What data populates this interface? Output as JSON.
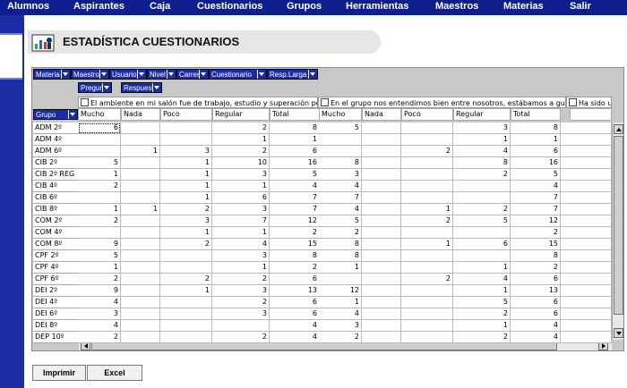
{
  "nav": [
    "Alumnos",
    "Aspirantes",
    "Caja",
    "Cuestionarios",
    "Grupos",
    "Herramientas",
    "Maestros",
    "Materias",
    "Salir"
  ],
  "page_title": "ESTADÍSTICA CUESTIONARIOS",
  "filter_fields": [
    "Materia",
    "Maestro",
    "Usuario",
    "Nivel",
    "Carrera",
    "Cuestionario",
    "Resp.Larga"
  ],
  "column_fields": [
    "Pregunta",
    "Respuesta"
  ],
  "row_field": "Grupo",
  "questions": [
    "El ambiente en mi salón fue de trabajo, estudio y superación personal.",
    "En el grupo nos entendimos bien entre nosotros, estábamos a gusto.",
    "Ha sido un"
  ],
  "answer_columns": [
    "Mucho",
    "Nada",
    "Poco",
    "Regular",
    "Total"
  ],
  "rows": [
    {
      "g": "ADM 2º",
      "q1": [
        "6",
        "",
        "",
        "2",
        "8"
      ],
      "q2": [
        "5",
        "",
        "",
        "3",
        "8"
      ]
    },
    {
      "g": "ADM 4º",
      "q1": [
        "",
        "",
        "",
        "1",
        "1"
      ],
      "q2": [
        "",
        "",
        "",
        "1",
        "1"
      ]
    },
    {
      "g": "ADM 6º",
      "q1": [
        "",
        "1",
        "3",
        "2",
        "6"
      ],
      "q2": [
        "",
        "",
        "2",
        "4",
        "6"
      ]
    },
    {
      "g": "CIB 2º",
      "q1": [
        "5",
        "",
        "1",
        "10",
        "16"
      ],
      "q2": [
        "8",
        "",
        "",
        "8",
        "16"
      ]
    },
    {
      "g": "CIB 2º REG",
      "q1": [
        "1",
        "",
        "1",
        "3",
        "5"
      ],
      "q2": [
        "3",
        "",
        "",
        "2",
        "5"
      ]
    },
    {
      "g": "CIB 4º",
      "q1": [
        "2",
        "",
        "1",
        "1",
        "4"
      ],
      "q2": [
        "4",
        "",
        "",
        "",
        "4"
      ]
    },
    {
      "g": "CIB 6º",
      "q1": [
        "",
        "",
        "1",
        "6",
        "7"
      ],
      "q2": [
        "7",
        "",
        "",
        "",
        "7"
      ]
    },
    {
      "g": "CIB 8º",
      "q1": [
        "1",
        "1",
        "2",
        "3",
        "7"
      ],
      "q2": [
        "4",
        "",
        "1",
        "2",
        "7"
      ]
    },
    {
      "g": "COM 2º",
      "q1": [
        "2",
        "",
        "3",
        "7",
        "12"
      ],
      "q2": [
        "5",
        "",
        "2",
        "5",
        "12"
      ]
    },
    {
      "g": "COM 4º",
      "q1": [
        "",
        "",
        "1",
        "1",
        "2"
      ],
      "q2": [
        "2",
        "",
        "",
        "",
        "2"
      ]
    },
    {
      "g": "COM 8º",
      "q1": [
        "9",
        "",
        "2",
        "4",
        "15"
      ],
      "q2": [
        "8",
        "",
        "1",
        "6",
        "15"
      ]
    },
    {
      "g": "CPF 2º",
      "q1": [
        "5",
        "",
        "",
        "3",
        "8"
      ],
      "q2": [
        "8",
        "",
        "",
        "",
        "8"
      ]
    },
    {
      "g": "CPF 4º",
      "q1": [
        "1",
        "",
        "",
        "1",
        "2"
      ],
      "q2": [
        "1",
        "",
        "",
        "1",
        "2"
      ]
    },
    {
      "g": "CPF 6º",
      "q1": [
        "2",
        "",
        "2",
        "2",
        "6"
      ],
      "q2": [
        "",
        "",
        "2",
        "4",
        "6"
      ]
    },
    {
      "g": "DEI 2º",
      "q1": [
        "9",
        "",
        "1",
        "3",
        "13"
      ],
      "q2": [
        "12",
        "",
        "",
        "1",
        "13"
      ]
    },
    {
      "g": "DEI 4º",
      "q1": [
        "4",
        "",
        "",
        "2",
        "6"
      ],
      "q2": [
        "1",
        "",
        "",
        "5",
        "6"
      ]
    },
    {
      "g": "DEI 6º",
      "q1": [
        "3",
        "",
        "",
        "3",
        "6"
      ],
      "q2": [
        "4",
        "",
        "",
        "2",
        "6"
      ]
    },
    {
      "g": "DEI 8º",
      "q1": [
        "4",
        "",
        "",
        "",
        "4"
      ],
      "q2": [
        "3",
        "",
        "",
        "1",
        "4"
      ]
    },
    {
      "g": "DEP 10º",
      "q1": [
        "2",
        "",
        "",
        "2",
        "4"
      ],
      "q2": [
        "2",
        "",
        "",
        "2",
        "4"
      ]
    }
  ],
  "buttons": {
    "print": "Imprimir",
    "excel": "Excel"
  },
  "colors": {
    "nav": "#0f1e8e",
    "field": "#1a2ca6",
    "grid": "#c8c8c8"
  }
}
